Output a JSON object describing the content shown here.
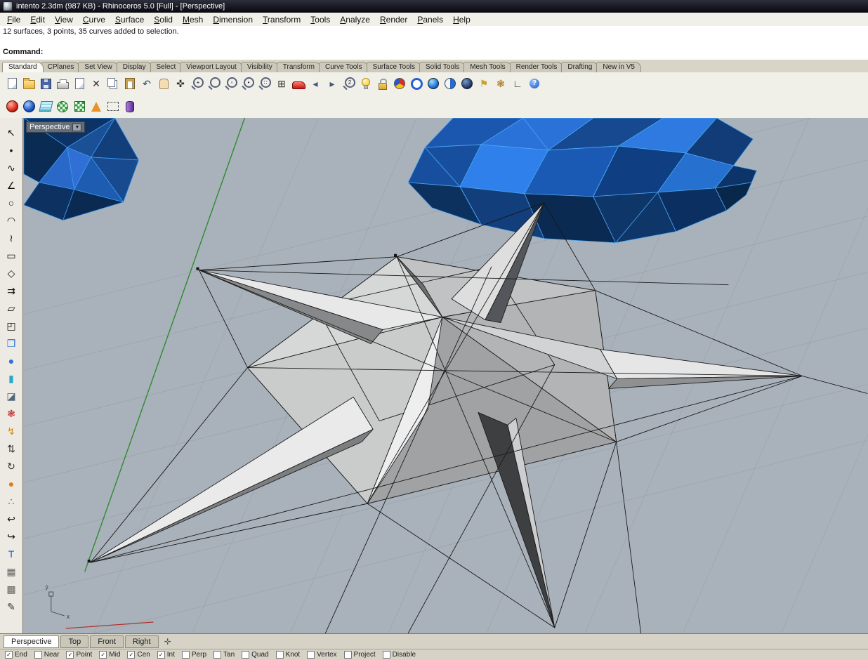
{
  "window": {
    "title": "intento 2.3dm (987 KB) - Rhinoceros 5.0 [Full] - [Perspective]"
  },
  "menu": {
    "items": [
      "File",
      "Edit",
      "View",
      "Curve",
      "Surface",
      "Solid",
      "Mesh",
      "Dimension",
      "Transform",
      "Tools",
      "Analyze",
      "Render",
      "Panels",
      "Help"
    ]
  },
  "command": {
    "history": "12 surfaces, 3 points, 35 curves added to selection.",
    "prompt": "Command:"
  },
  "toolbar_tabs": [
    {
      "label": "Standard",
      "state": "active"
    },
    {
      "label": "CPlanes"
    },
    {
      "label": "Set View"
    },
    {
      "label": "Display"
    },
    {
      "label": "Select"
    },
    {
      "label": "Viewport Layout"
    },
    {
      "label": "Visibility"
    },
    {
      "label": "Transform"
    },
    {
      "label": "Curve Tools"
    },
    {
      "label": "Surface Tools"
    },
    {
      "label": "Solid Tools"
    },
    {
      "label": "Mesh Tools"
    },
    {
      "label": "Render Tools"
    },
    {
      "label": "Drafting"
    },
    {
      "label": "New in V5"
    }
  ],
  "toolbar_main": [
    {
      "name": "new-file-icon",
      "cls": "ic-page"
    },
    {
      "name": "open-file-icon",
      "cls": "ic-folder"
    },
    {
      "name": "save-icon",
      "cls": "ic-floppy"
    },
    {
      "name": "print-icon",
      "cls": "ic-printer"
    },
    {
      "name": "copy-to-clipboard-icon",
      "cls": "ic-page"
    },
    {
      "name": "cut-icon",
      "glyph": "✕",
      "color": "#333333"
    },
    {
      "name": "copy-icon",
      "cls": "ic-copy"
    },
    {
      "name": "paste-icon",
      "cls": "ic-paste"
    },
    {
      "name": "undo-icon",
      "glyph": "↶",
      "color": "#223a66"
    },
    {
      "name": "pan-hand-icon",
      "cls": "ic-hand"
    },
    {
      "name": "move-icon",
      "glyph": "✜",
      "color": "#333333"
    },
    {
      "name": "zoom-in-icon",
      "cls": "ic-mag",
      "glyph": "+"
    },
    {
      "name": "zoom-dynamic-icon",
      "cls": "ic-mag"
    },
    {
      "name": "zoom-window-icon",
      "cls": "ic-mag",
      "glyph": "▫"
    },
    {
      "name": "zoom-selected-icon",
      "cls": "ic-mag",
      "glyph": "•"
    },
    {
      "name": "zoom-extents-icon",
      "cls": "ic-mag",
      "glyph": "∷"
    },
    {
      "name": "viewport-layout-icon",
      "glyph": "⊞",
      "color": "#333333"
    },
    {
      "name": "car-icon",
      "cls": "ic-car"
    },
    {
      "name": "prev-view-icon",
      "glyph": "◂",
      "color": "#445577"
    },
    {
      "name": "next-view-icon",
      "glyph": "▸",
      "color": "#445577"
    },
    {
      "name": "zoom-2d-icon",
      "cls": "ic-mag",
      "glyph": "2"
    },
    {
      "name": "lights-icon",
      "cls": "ic-bulb"
    },
    {
      "name": "lock-icon",
      "cls": "ic-lock"
    },
    {
      "name": "layer-colors-icon",
      "cls": "ic-tricolor"
    },
    {
      "name": "wireframe-display-icon",
      "cls": "ic-globe-ring"
    },
    {
      "name": "shaded-display-icon",
      "cls": "ic-globe-blue"
    },
    {
      "name": "ghosted-display-icon",
      "cls": "ic-globe-half"
    },
    {
      "name": "rendered-display-icon",
      "cls": "ic-globe-dark"
    },
    {
      "name": "flag-icon",
      "glyph": "⚑",
      "color": "#c9a227"
    },
    {
      "name": "gears-icon",
      "glyph": "❃",
      "color": "#b07818"
    },
    {
      "name": "cplane-icon",
      "glyph": "∟",
      "color": "#333333"
    },
    {
      "name": "help-icon",
      "cls": "ic-help",
      "glyph": "?"
    }
  ],
  "toolbar_secondary": [
    {
      "name": "render-sphere-red-icon",
      "cls": "ic-ball-red"
    },
    {
      "name": "render-sphere-blue-icon",
      "cls": "ic-ball-blue"
    },
    {
      "name": "layers-panel-icon",
      "cls": "ic-stack"
    },
    {
      "name": "checkered-sphere-icon",
      "cls": "ic-check-sph"
    },
    {
      "name": "checkered-box-icon",
      "cls": "ic-check-box"
    },
    {
      "name": "cone-icon",
      "cls": "ic-cone"
    },
    {
      "name": "bounding-box-icon",
      "cls": "ic-bbox"
    },
    {
      "name": "block-cylinder-icon",
      "cls": "ic-cyl"
    }
  ],
  "sidebar": [
    {
      "name": "select-arrow-icon",
      "glyph": "↖",
      "color": "#111111"
    },
    {
      "name": "point-icon",
      "glyph": "•",
      "color": "#111111"
    },
    {
      "name": "curve-icon",
      "glyph": "∿",
      "color": "#111111"
    },
    {
      "name": "polyline-icon",
      "glyph": "∠",
      "color": "#111111"
    },
    {
      "name": "circle-icon",
      "glyph": "○",
      "color": "#111111"
    },
    {
      "name": "arc-icon",
      "glyph": "◠",
      "color": "#111111"
    },
    {
      "name": "freeform-curve-icon",
      "glyph": "≀",
      "color": "#111111"
    },
    {
      "name": "rectangle-icon",
      "glyph": "▭",
      "color": "#111111"
    },
    {
      "name": "polygon-icon",
      "glyph": "◇",
      "color": "#111111"
    },
    {
      "name": "offset-icon",
      "glyph": "⇉",
      "color": "#111111"
    },
    {
      "name": "surface-icon",
      "glyph": "▱",
      "color": "#111111"
    },
    {
      "name": "surface-corner-icon",
      "glyph": "◰",
      "color": "#111111"
    },
    {
      "name": "box-icon",
      "glyph": "❒",
      "color": "#2f6fd6"
    },
    {
      "name": "sphere-icon",
      "glyph": "●",
      "color": "#2f6fd6"
    },
    {
      "name": "cylinder-icon",
      "glyph": "▮",
      "color": "#2aa8c8"
    },
    {
      "name": "plane-icon",
      "glyph": "◪",
      "color": "#556677"
    },
    {
      "name": "gears-red-icon",
      "glyph": "❃",
      "color": "#c03030"
    },
    {
      "name": "lightning-icon",
      "glyph": "↯",
      "color": "#d78a00"
    },
    {
      "name": "drag-icon",
      "glyph": "⇅",
      "color": "#333333"
    },
    {
      "name": "rotate-icon",
      "glyph": "↻",
      "color": "#333333"
    },
    {
      "name": "material-ball-icon",
      "glyph": "●",
      "color": "#e07b1a"
    },
    {
      "name": "points-set-icon",
      "glyph": "∴",
      "color": "#2255cc"
    },
    {
      "name": "hook-left-icon",
      "glyph": "↩",
      "color": "#111111"
    },
    {
      "name": "hook-right-icon",
      "glyph": "↪",
      "color": "#111111"
    },
    {
      "name": "pin-t-icon",
      "glyph": "T",
      "color": "#2255cc"
    },
    {
      "name": "blocks-icon",
      "glyph": "▦",
      "color": "#666666"
    },
    {
      "name": "grid-snap-icon",
      "glyph": "▩",
      "color": "#666666"
    },
    {
      "name": "annotate-icon",
      "glyph": "✎",
      "color": "#333333"
    }
  ],
  "viewport": {
    "label": "Perspective",
    "dropdown_glyph": "▼",
    "axis_label_x": "x",
    "axis_label_y": "ŷ"
  },
  "viewport_tabs": [
    {
      "label": "Perspective",
      "state": "active"
    },
    {
      "label": "Top"
    },
    {
      "label": "Front"
    },
    {
      "label": "Right"
    }
  ],
  "pane_icon": "✛",
  "osnap": {
    "items": [
      {
        "label": "End",
        "state": "on"
      },
      {
        "label": "Near"
      },
      {
        "label": "Point",
        "state": "on"
      },
      {
        "label": "Mid",
        "state": "on"
      },
      {
        "label": "Cen",
        "state": "on"
      },
      {
        "label": "Int",
        "state": "on"
      },
      {
        "label": "Perp"
      },
      {
        "label": "Tan"
      },
      {
        "label": "Quad"
      },
      {
        "label": "Knot"
      },
      {
        "label": "Vertex"
      },
      {
        "label": "Project"
      },
      {
        "label": "Disable"
      }
    ]
  },
  "colors": {
    "titlebar_bg": "#101018",
    "viewport_bg": "#a9b2ba",
    "axis_green": "#2e8b2e",
    "axis_red": "#b03030",
    "model_blue": "#1d5cb0",
    "model_edge_cyan": "#4aa6f2",
    "star_gray": "#c6c8c9"
  }
}
